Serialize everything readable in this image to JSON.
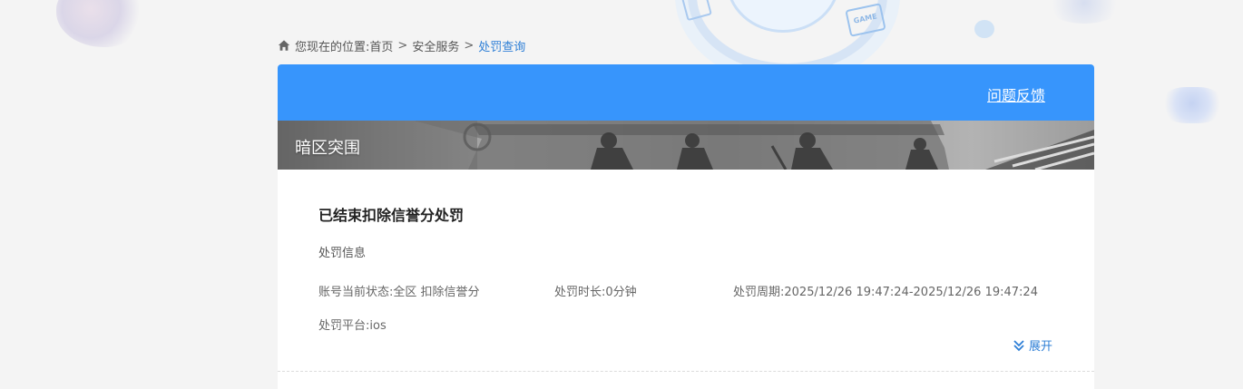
{
  "breadcrumb": {
    "prefix": "您现在的位置:",
    "items": [
      "首页",
      "安全服务"
    ],
    "separator": ">",
    "current": "处罚查询"
  },
  "header": {
    "feedback_label": "问题反馈"
  },
  "game": {
    "title": "暗区突围"
  },
  "punishment": {
    "title": "已结束扣除信誉分处罚",
    "info_heading": "处罚信息",
    "status_label": "账号当前状态:",
    "status_value": "全区 扣除信誉分",
    "duration_label": "处罚时长:",
    "duration_value": "0分钟",
    "period_label": "处罚周期:",
    "period_value": "2025/12/26 19:47:24-2025/12/26 19:47:24",
    "platform_label": "处罚平台:",
    "platform_value": "ios",
    "expand_label": "展开"
  },
  "colors": {
    "header_blue": "#3795fc",
    "link_blue": "#2e7fd6",
    "page_bg": "#f4f4f4"
  },
  "icons": {
    "home": "home-icon",
    "expand": "double-chevron-down-icon"
  }
}
